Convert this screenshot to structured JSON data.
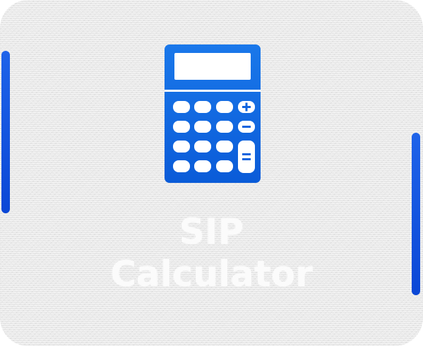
{
  "card": {
    "title_line_1": "SIP",
    "title_line_2": "Calculator",
    "icon": "calculator-icon"
  },
  "colors": {
    "accent": "#0b47d6",
    "icon_top": "#1a73e8",
    "icon_bottom": "#0b5bd9",
    "title_text": "#fbfbfb"
  }
}
